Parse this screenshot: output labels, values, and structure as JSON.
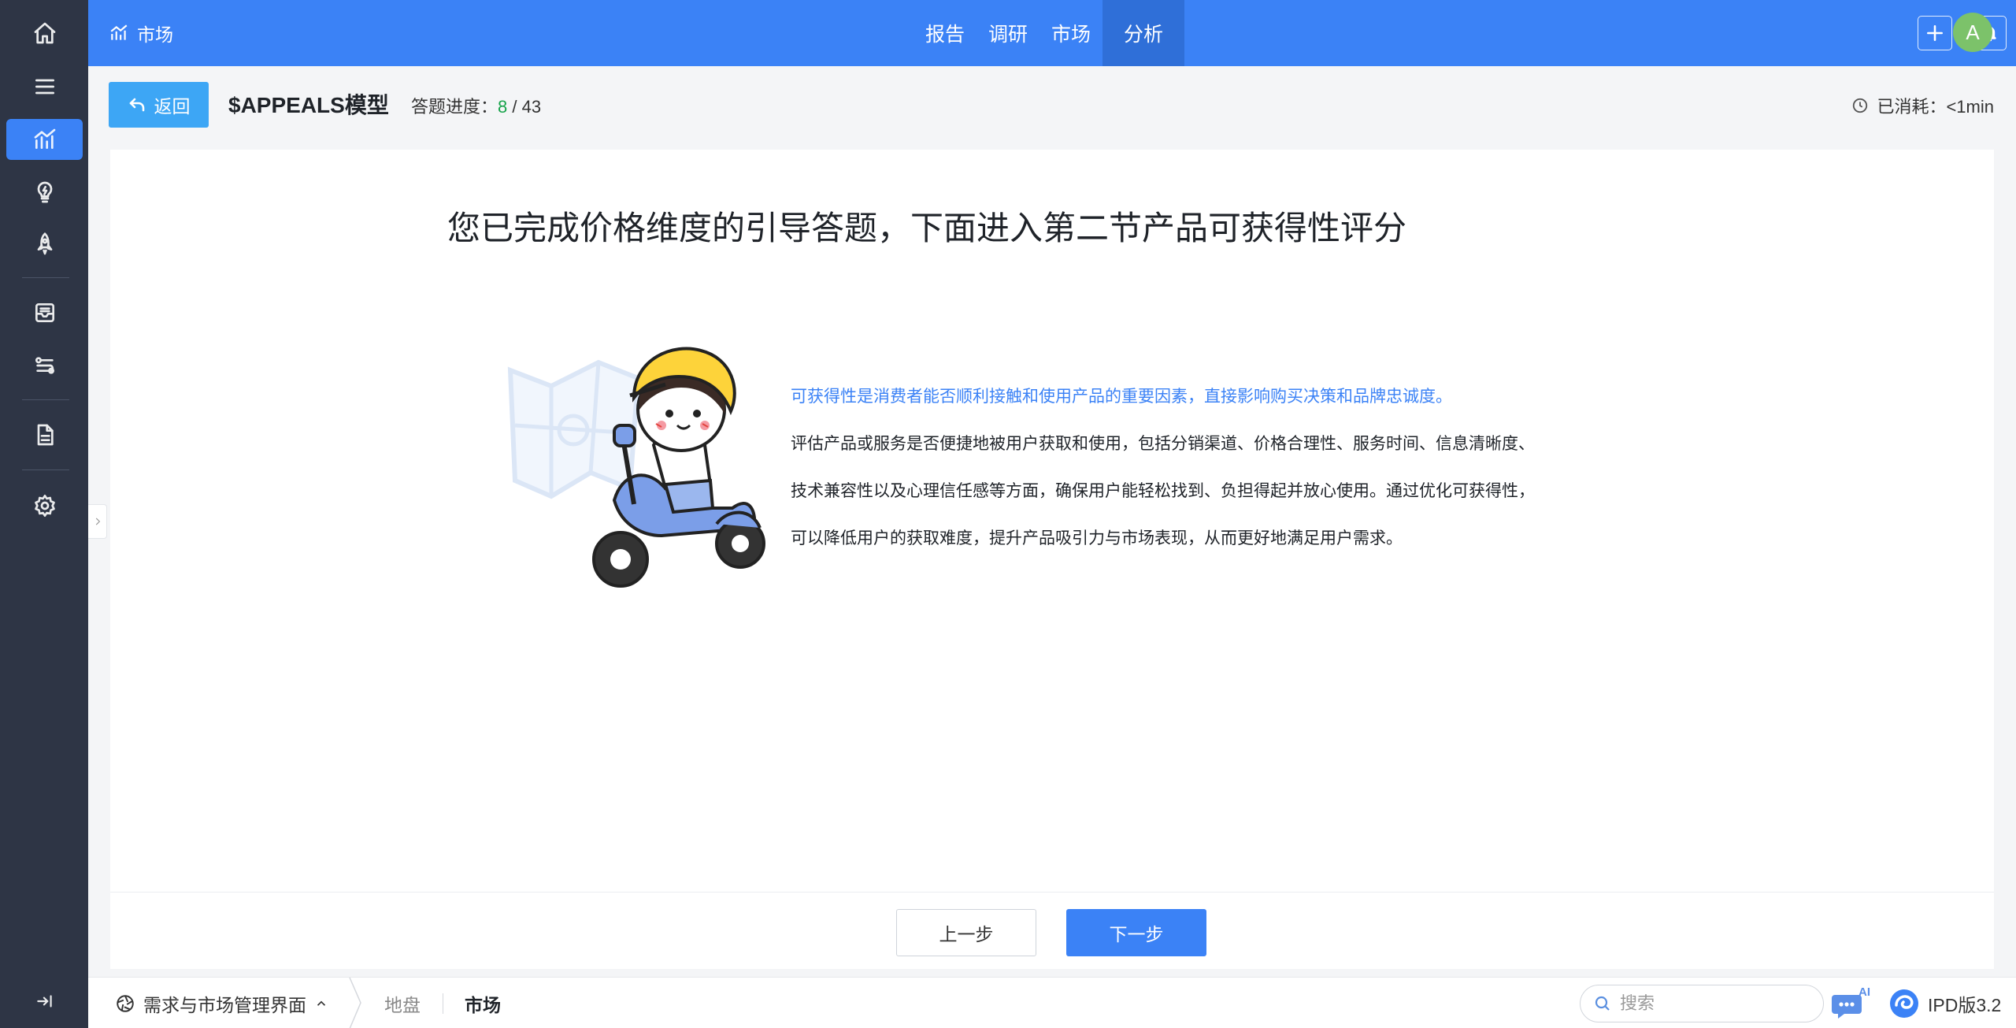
{
  "topbar": {
    "brand": "市场",
    "nav": [
      "报告",
      "调研",
      "市场",
      "分析"
    ],
    "avatar_letter": "A"
  },
  "header": {
    "back_label": "返回",
    "title": "$APPEALS模型",
    "progress_label": "答题进度：",
    "progress_current": "8",
    "progress_total": " / 43",
    "elapsed_label": "已消耗：<1min"
  },
  "content": {
    "headline": "您已完成价格维度的引导答题，下面进入第二节产品可获得性评分",
    "highlight": "可获得性是消费者能否顺利接触和使用产品的重要因素，直接影响购买决策和品牌忠诚度。",
    "body_lines": [
      "评估产品或服务是否便捷地被用户获取和使用，包括分销渠道、价格合理性、服务时间、信息清晰度、",
      "技术兼容性以及心理信任感等方面，确保用户能轻松找到、负担得起并放心使用。通过优化可获得性，",
      "可以降低用户的获取难度，提升产品吸引力与市场表现，从而更好地满足用户需求。"
    ],
    "prev_label": "上一步",
    "next_label": "下一步"
  },
  "bottombar": {
    "workspace": "需求与市场管理界面",
    "crumbs": [
      "地盘",
      "市场"
    ],
    "search_placeholder": "搜索",
    "ai_badge": "AI",
    "version": "IPD版3.2"
  },
  "colors": {
    "primary": "#3b82f6",
    "sidebar": "#2e3545",
    "back_button": "#3da6f5",
    "progress_current": "#16a34a"
  }
}
